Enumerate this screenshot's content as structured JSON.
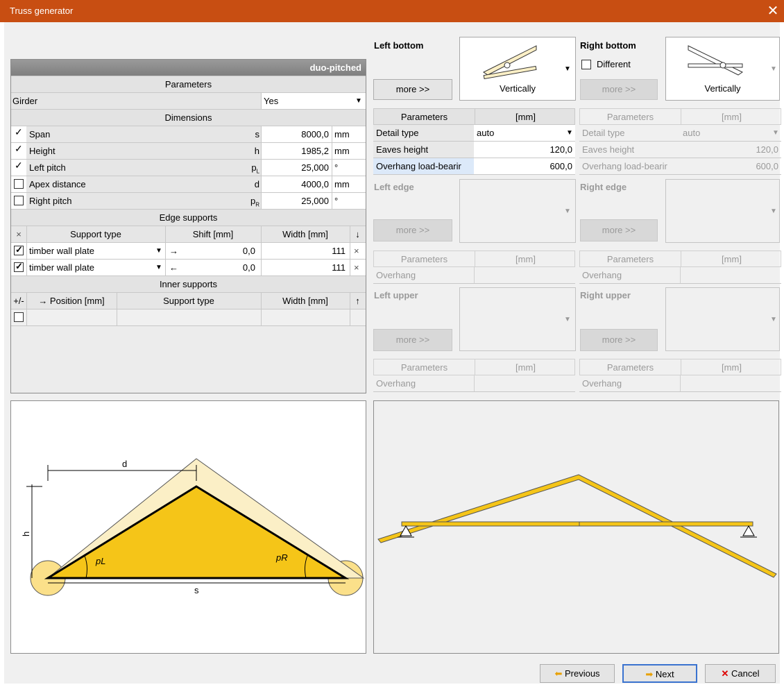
{
  "window": {
    "title": "Truss generator",
    "close": "✕"
  },
  "left_table": {
    "type_label": "duo-pitched",
    "parameters_header": "Parameters",
    "girder": {
      "label": "Girder",
      "value": "Yes"
    },
    "dimensions_header": "Dimensions",
    "dimensions": [
      {
        "label": "Span",
        "symbol": "s",
        "value": "8000,0",
        "unit": "mm",
        "state": "tick"
      },
      {
        "label": "Height",
        "symbol": "h",
        "value": "1985,2",
        "unit": "mm",
        "state": "tick"
      },
      {
        "label": "Left pitch",
        "symbol": "pL",
        "value": "25,000",
        "unit": "°",
        "state": "tick"
      },
      {
        "label": "Apex distance",
        "symbol": "d",
        "value": "4000,0",
        "unit": "mm",
        "state": "unchecked"
      },
      {
        "label": "Right pitch",
        "symbol": "pR",
        "value": "25,000",
        "unit": "°",
        "state": "unchecked"
      }
    ],
    "edge_supports_header": "Edge supports",
    "edge_columns": {
      "x": "×",
      "type": "Support type",
      "shift": "Shift [mm]",
      "width": "Width [mm]",
      "sort": "↓"
    },
    "edge_supports": [
      {
        "type": "timber wall plate",
        "dir": "→",
        "shift": "0,0",
        "width": "111",
        "remove": "×"
      },
      {
        "type": "timber wall plate",
        "dir": "←",
        "shift": "0,0",
        "width": "111",
        "remove": "×"
      }
    ],
    "inner_supports_header": "Inner supports",
    "inner_columns": {
      "pm": "+/-",
      "position": "→ Position [mm]",
      "type": "Support type",
      "width": "Width [mm]",
      "sort": "↑"
    }
  },
  "left_bottom": {
    "title": "Left bottom",
    "more": "more >>",
    "image_label": "Vertically"
  },
  "right_bottom": {
    "title": "Right bottom",
    "different": "Different",
    "more": "more >>",
    "image_label": "Vertically"
  },
  "lb_params": {
    "header": [
      "Parameters",
      "[mm]"
    ],
    "rows": [
      {
        "label": "Detail type",
        "value": "auto"
      },
      {
        "label": "Eaves height",
        "value": "120,0"
      },
      {
        "label": "Overhang load-bearir",
        "value": "600,0"
      }
    ]
  },
  "rb_params": {
    "header": [
      "Parameters",
      "[mm]"
    ],
    "rows": [
      {
        "label": "Detail type",
        "value": "auto"
      },
      {
        "label": "Eaves height",
        "value": "120,0"
      },
      {
        "label": "Overhang load-bearir",
        "value": "600,0"
      }
    ]
  },
  "left_edge": {
    "title": "Left edge",
    "more": "more >>",
    "header": [
      "Parameters",
      "[mm]"
    ],
    "row": "Overhang"
  },
  "right_edge": {
    "title": "Right edge",
    "more": "more >>",
    "header": [
      "Parameters",
      "[mm]"
    ],
    "row": "Overhang"
  },
  "left_upper": {
    "title": "Left upper",
    "more": "more >>",
    "header": [
      "Parameters",
      "[mm]"
    ],
    "row": "Overhang"
  },
  "right_upper": {
    "title": "Right upper",
    "more": "more >>",
    "header": [
      "Parameters",
      "[mm]"
    ],
    "row": "Overhang"
  },
  "diagram": {
    "d": "d",
    "h": "h",
    "s": "s",
    "pL": "pL",
    "pR": "pR"
  },
  "footer": {
    "previous": "Previous",
    "next": "Next",
    "cancel": "Cancel"
  },
  "colors": {
    "titlebar": "#c84e12",
    "timber": "#f5c518",
    "timber_light": "#fbefc6"
  }
}
